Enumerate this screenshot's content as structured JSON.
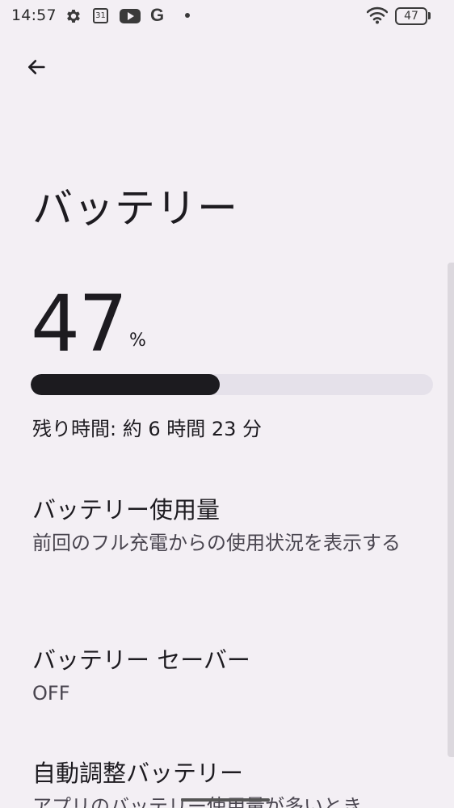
{
  "status_bar": {
    "time": "14:57",
    "calendar_day": "31",
    "google_letter": "G",
    "battery_level": "47",
    "icons": [
      "settings-gear-icon",
      "calendar-icon",
      "youtube-icon",
      "google-icon",
      "notification-dot-icon",
      "wifi-icon",
      "battery-icon"
    ]
  },
  "header": {
    "back_icon": "arrow-back-icon",
    "title": "バッテリー"
  },
  "battery": {
    "level_value": "47",
    "level_unit": "%",
    "level_fraction": 0.47,
    "time_remaining": "残り時間: 約 6 時間 23 分"
  },
  "items": [
    {
      "title": "バッテリー使用量",
      "summary": "前回のフル充電からの使用状況を表示する"
    },
    {
      "title": "バッテリー セーバー",
      "summary": "OFF"
    },
    {
      "title": "自動調整バッテリー",
      "summary": "アプリのバッテリー使用量が多いとき"
    }
  ],
  "colors": {
    "background": "#f3eff4",
    "progress_fill": "#1c1b1f",
    "progress_track": "#e5e1ea",
    "primary_text": "#1d1b20",
    "secondary_text": "#49454f"
  }
}
